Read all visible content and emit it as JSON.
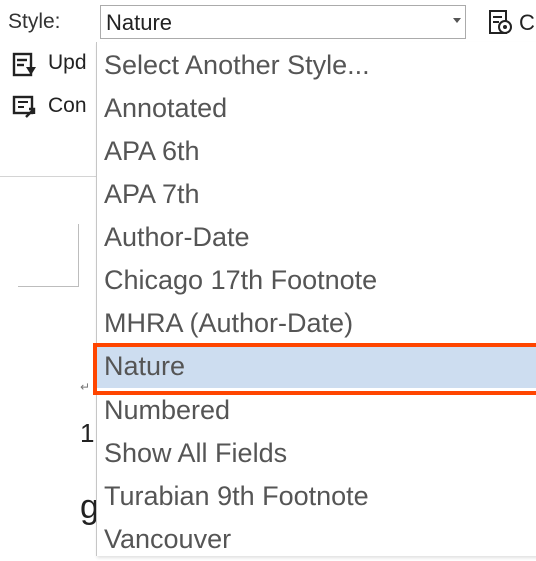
{
  "ribbon": {
    "style_label": "Style:",
    "style_value": "Nature",
    "settings_label": "C",
    "update_label": "Upd",
    "convert_label": "Con"
  },
  "document": {
    "para_mark": "↵",
    "line1": "1",
    "line2": "g"
  },
  "dropdown": {
    "items": [
      "Select Another Style...",
      "Annotated",
      "APA 6th",
      "APA 7th",
      "Author-Date",
      "Chicago 17th Footnote",
      "MHRA (Author-Date)",
      "Nature",
      "Numbered",
      "Show All Fields",
      "Turabian 9th Footnote",
      "Vancouver"
    ],
    "selected": "Nature"
  },
  "colors": {
    "selected_bg": "#cdddf0",
    "highlight_border": "#ff4500"
  }
}
